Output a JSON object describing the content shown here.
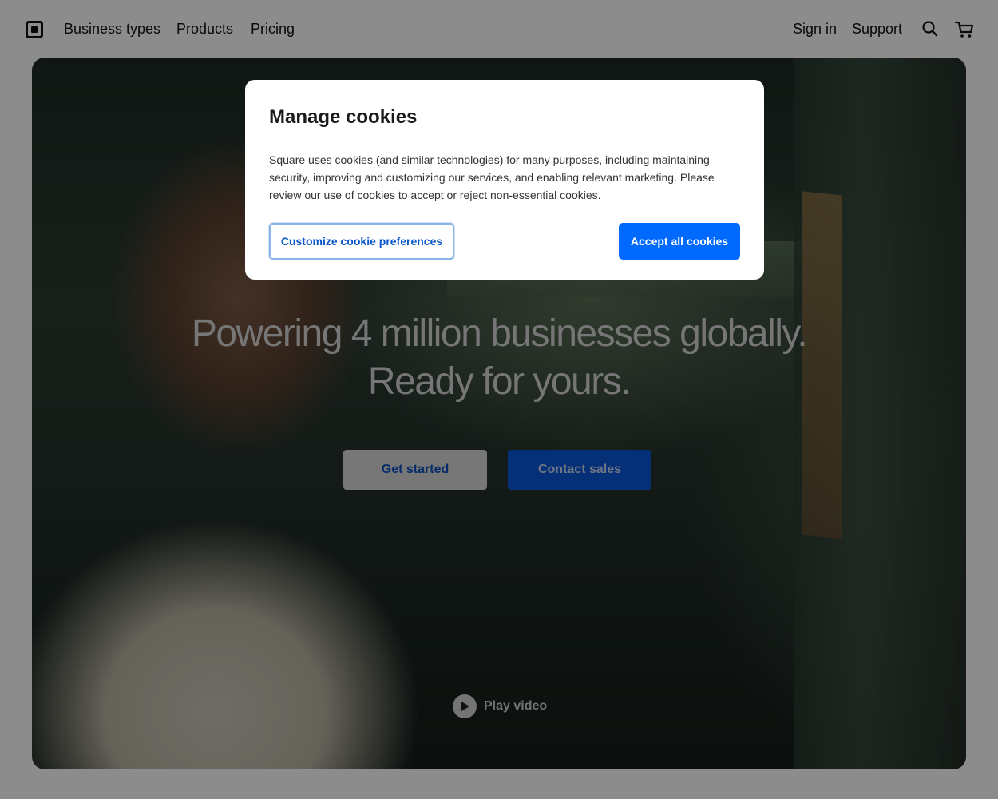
{
  "nav": {
    "logo_icon": "square-logo-icon",
    "links": [
      "Business types",
      "Products",
      "Pricing"
    ],
    "sign_in": "Sign in",
    "support": "Support",
    "search_icon": "search-icon",
    "cart_icon": "cart-icon"
  },
  "hero": {
    "title_line1": "Powering 4 million businesses globally.",
    "title_line2": "Ready for yours.",
    "get_started": "Get started",
    "contact_sales": "Contact sales",
    "play_video": "Play video",
    "play_icon": "play-icon"
  },
  "cookie_modal": {
    "title": "Manage cookies",
    "body": "Square uses cookies (and similar technologies) for many purposes, including maintaining security, improving and customizing our services, and enabling relevant marketing. Please review our use of cookies to accept or reject non-essential cookies.",
    "customize_button": "Customize cookie preferences",
    "accept_button": "Accept all cookies"
  },
  "colors": {
    "accent": "#006aff",
    "overlay": "rgba(0,0,0,0.45)",
    "text": "#111111"
  }
}
